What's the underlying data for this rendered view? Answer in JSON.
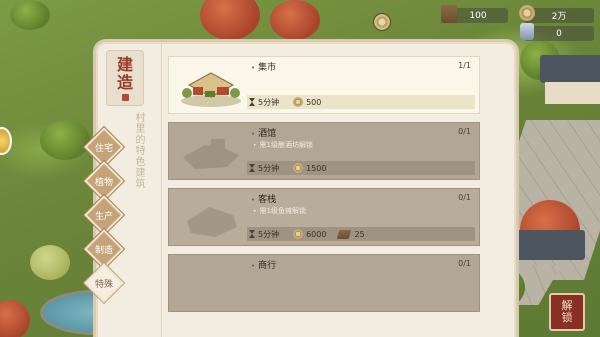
{
  "hud": {
    "wood": "100",
    "money": "2万",
    "gems": "0"
  },
  "panel": {
    "title_chars": [
      "建",
      "造"
    ],
    "subtitle": "村里的特色建筑",
    "tabs": [
      {
        "label": "住宅",
        "active": false
      },
      {
        "label": "植物",
        "active": false
      },
      {
        "label": "生产",
        "active": false
      },
      {
        "label": "制造",
        "active": false
      },
      {
        "label": "特殊",
        "active": true
      }
    ],
    "buildings": [
      {
        "name": "集市",
        "count": "1/1",
        "locked": false,
        "requirement": "",
        "time": "5分钟",
        "coins": "500",
        "wood": ""
      },
      {
        "name": "酒馆",
        "count": "0/1",
        "locked": true,
        "requirement": "需1级酿酒坊解锁",
        "time": "5分钟",
        "coins": "1500",
        "wood": ""
      },
      {
        "name": "客栈",
        "count": "0/1",
        "locked": true,
        "requirement": "需1级鱼摊解锁",
        "time": "5分钟",
        "coins": "6000",
        "wood": "25"
      },
      {
        "name": "商行",
        "count": "0/1",
        "locked": true,
        "requirement": "",
        "time": "",
        "coins": "",
        "wood": ""
      }
    ]
  },
  "unlock_button": [
    "解",
    "锁"
  ],
  "colors": {
    "panel_bg": "#f3ece0",
    "locked_card": "#b2a797",
    "tab_brown": "#c3a377",
    "accent_red": "#8a2f25"
  }
}
